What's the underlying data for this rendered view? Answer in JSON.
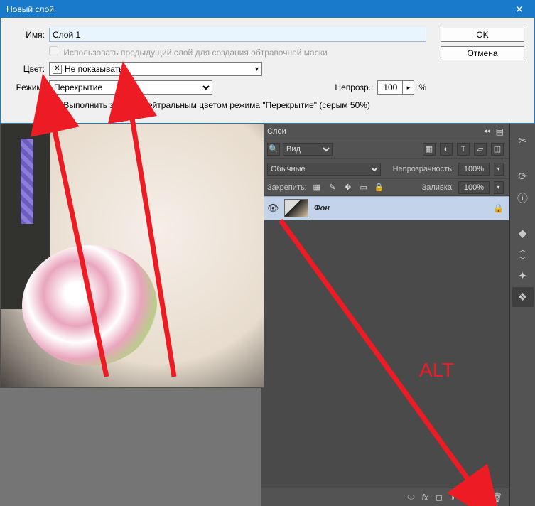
{
  "dialog": {
    "title": "Новый слой",
    "name_label": "Имя:",
    "name_value": "Слой 1",
    "ok": "OK",
    "cancel": "Отмена",
    "use_prev": "Использовать предыдущий слой для создания обтравочной маски",
    "color_label": "Цвет:",
    "color_value": "Не показывать",
    "mode_label": "Режим:",
    "mode_value": "Перекрытие",
    "opacity_label": "Непрозр.:",
    "opacity_value": "100",
    "opacity_pct": "%",
    "fill_neutral": "Выполнить заливку нейтральным цветом режима \"Перекрытие\"  (серым 50%)"
  },
  "layers_panel": {
    "title": "Слои",
    "filter_kind": "Вид",
    "blend_mode": "Обычные",
    "opacity_label": "Непрозрачность:",
    "opacity_value": "100%",
    "lock_label": "Закрепить:",
    "fill_label": "Заливка:",
    "fill_value": "100%",
    "layer_name": "Фон"
  },
  "annotation": {
    "alt": "ALT"
  }
}
